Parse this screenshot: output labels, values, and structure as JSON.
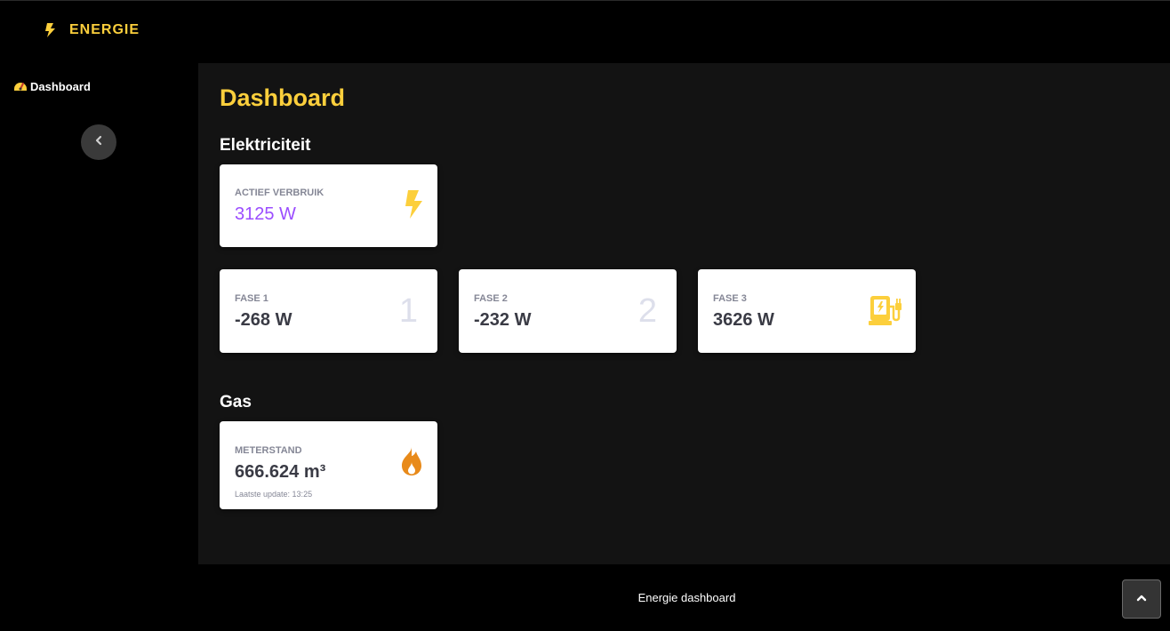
{
  "brand": {
    "name": "ENERGIE",
    "icon": "bolt-icon",
    "accent": "#fccf3c"
  },
  "sidebar": {
    "items": [
      {
        "label": "Dashboard",
        "icon": "tachometer-icon"
      }
    ],
    "collapse_icon": "chevron-left-icon"
  },
  "main": {
    "title": "Dashboard",
    "sections": {
      "electricity": {
        "title": "Elektriciteit",
        "active": {
          "label": "Actief verbruik",
          "value": "3125 W",
          "value_color": "#9b4dff",
          "icon": "bolt-icon"
        },
        "phases": [
          {
            "label": "Fase 1",
            "value": "-268 W",
            "badge": "1"
          },
          {
            "label": "Fase 2",
            "value": "-232 W",
            "badge": "2"
          },
          {
            "label": "Fase 3",
            "value": "3626 W",
            "icon": "charging-station-icon"
          }
        ]
      },
      "gas": {
        "title": "Gas",
        "meter": {
          "label": "Meterstand",
          "value": "666.624 m³",
          "note": "Laatste update: 13:25",
          "icon": "fire-icon",
          "icon_color": "#e88a1a"
        }
      }
    }
  },
  "footer": {
    "text": "Energie dashboard"
  },
  "scroll_top": {
    "icon": "chevron-up-icon"
  }
}
